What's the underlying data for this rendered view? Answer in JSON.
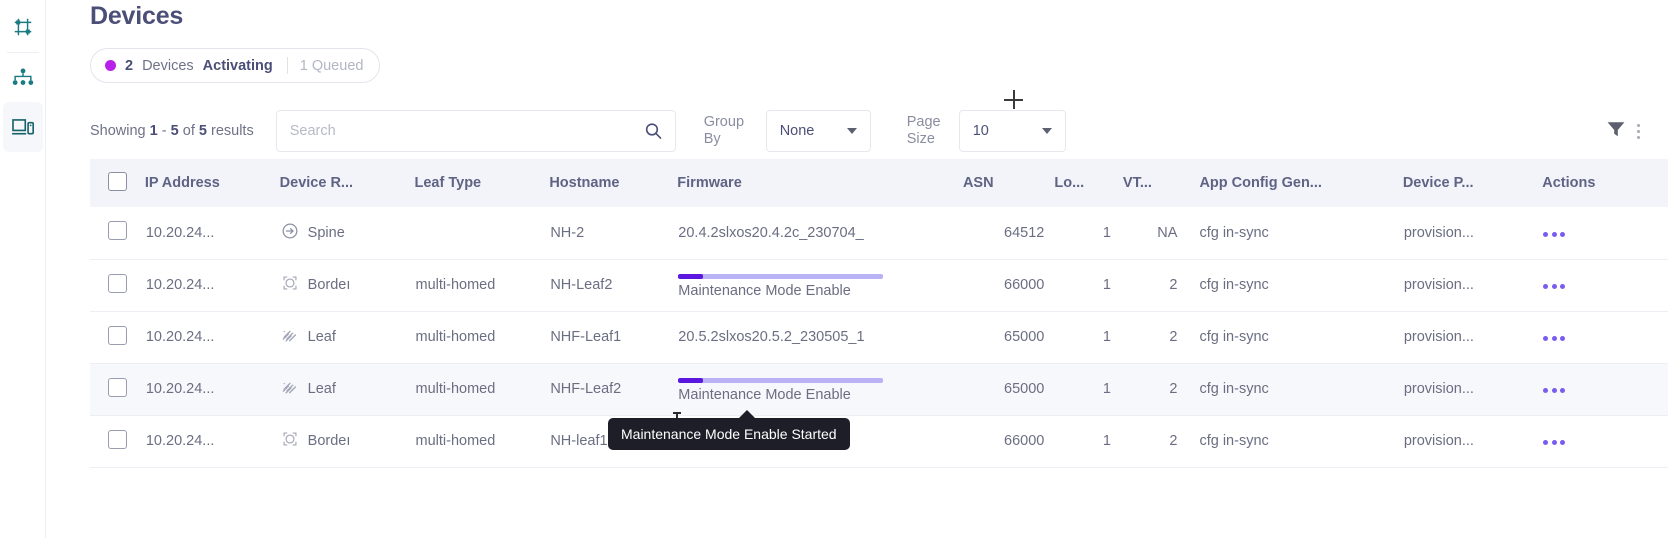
{
  "sidebar": {
    "items": [
      {
        "name": "fabric-settings",
        "icon": "sliders-grid-icon",
        "active": false
      },
      {
        "name": "topology",
        "icon": "topology-hierarchy-icon",
        "active": false
      },
      {
        "name": "devices",
        "icon": "devices-monitor-icon",
        "active": true
      }
    ]
  },
  "header": {
    "title": "Devices"
  },
  "status_pill": {
    "dot_color": "#b721e8",
    "count": "2",
    "word": "Devices",
    "state": "Activating",
    "separator": "|",
    "queued": "1 Queued"
  },
  "toolbar": {
    "showing_prefix": "Showing",
    "showing_from": "1",
    "showing_dash": "-",
    "showing_to": "5",
    "showing_of": "of",
    "showing_total": "5",
    "showing_suffix": "results",
    "search_placeholder": "Search",
    "search_value": "",
    "search_icon": "search-icon",
    "group_by_label": "Group By",
    "group_by_value": "None",
    "page_size_label": "Page Size",
    "page_size_value": "10",
    "filter_icon": "filter-funnel-icon",
    "overflow_icon": "kebab-vertical-icon"
  },
  "table": {
    "columns": [
      {
        "key": "select",
        "label": ""
      },
      {
        "key": "ip",
        "label": "IP Address"
      },
      {
        "key": "role",
        "label": "Device R..."
      },
      {
        "key": "leaf",
        "label": "Leaf Type"
      },
      {
        "key": "host",
        "label": "Hostname"
      },
      {
        "key": "fw",
        "label": "Firmware"
      },
      {
        "key": "asn",
        "label": "ASN"
      },
      {
        "key": "lo",
        "label": "Lo..."
      },
      {
        "key": "vtep",
        "label": "VT..."
      },
      {
        "key": "cfg",
        "label": "App Config Gen..."
      },
      {
        "key": "dps",
        "label": "Device P..."
      },
      {
        "key": "actions",
        "label": "Actions"
      }
    ],
    "rows": [
      {
        "ip": "10.20.24...",
        "role_icon": "spine-circle-arrow-icon",
        "role": "Spine",
        "leaf": "",
        "host": "NH-2",
        "firmware": "20.4.2slxos20.4.2c_230704_",
        "progress": null,
        "asn": "64512",
        "lo": "1",
        "vtep": "NA",
        "cfg": "cfg in-sync",
        "dps": "provision...",
        "highlight": false
      },
      {
        "ip": "10.20.24...",
        "role_icon": "border-leaf-icon",
        "role": "Bordeı",
        "leaf": "multi-homed",
        "host": "NH-Leaf2",
        "firmware": "Maintenance Mode Enable",
        "progress": 12,
        "asn": "66000",
        "lo": "1",
        "vtep": "2",
        "cfg": "cfg in-sync",
        "dps": "provision...",
        "highlight": false
      },
      {
        "ip": "10.20.24...",
        "role_icon": "leaf-hatched-icon",
        "role": "Leaf",
        "leaf": "multi-homed",
        "host": "NHF-Leaf1",
        "firmware": "20.5.2slxos20.5.2_230505_1",
        "progress": null,
        "asn": "65000",
        "lo": "1",
        "vtep": "2",
        "cfg": "cfg in-sync",
        "dps": "provision...",
        "highlight": false
      },
      {
        "ip": "10.20.24...",
        "role_icon": "leaf-hatched-icon",
        "role": "Leaf",
        "leaf": "multi-homed",
        "host": "NHF-Leaf2",
        "firmware": "Maintenance Mode Enable",
        "progress": 12,
        "asn": "65000",
        "lo": "1",
        "vtep": "2",
        "cfg": "cfg in-sync",
        "dps": "provision...",
        "highlight": true
      },
      {
        "ip": "10.20.24...",
        "role_icon": "border-leaf-icon",
        "role": "Bordeı",
        "leaf": "multi-homed",
        "host": "NH-leaf1",
        "firmware": "",
        "progress": null,
        "asn": "66000",
        "lo": "1",
        "vtep": "2",
        "cfg": "cfg in-sync",
        "dps": "provision...",
        "highlight": false
      }
    ],
    "actions_icon": "kebab-horizontal-icon"
  },
  "tooltip": {
    "text": "Maintenance Mode Enable Started"
  },
  "colors": {
    "accent_purple": "#7b5cf0",
    "progress_fill": "#5b17e0",
    "progress_track": "#b9b2f4",
    "title": "#4b4f78",
    "header_bg": "#f3f4f9",
    "sidebar_icon": "#1b7b82",
    "pill_dot": "#b721e8"
  }
}
